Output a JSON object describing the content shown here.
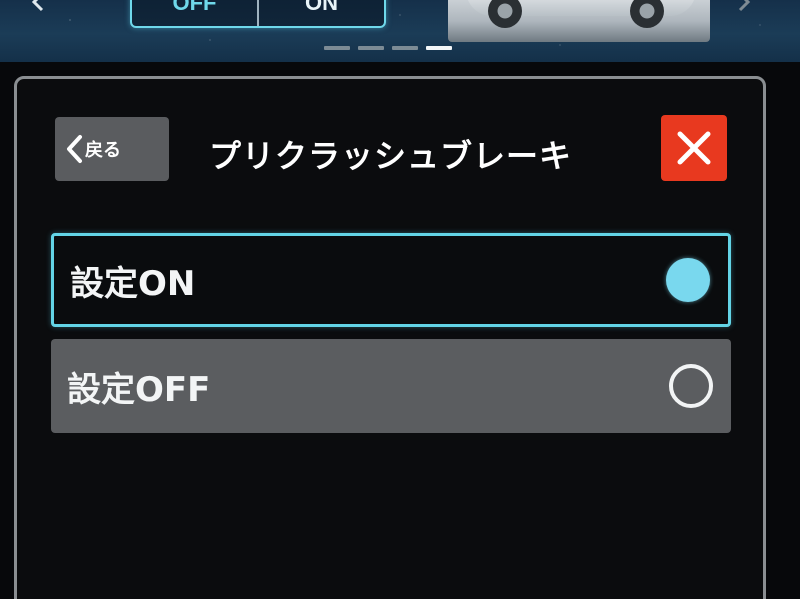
{
  "header": {
    "toggle": {
      "off_label": "OFF",
      "on_label": "ON"
    },
    "page_indicator": {
      "count": 4,
      "active_index": 3
    }
  },
  "dialog": {
    "back_label": "戻る",
    "title": "プリクラッシュブレーキ",
    "options": [
      {
        "label": "設定ON",
        "selected": true
      },
      {
        "label": "設定OFF",
        "selected": false
      }
    ]
  },
  "colors": {
    "accent": "#63d4e6",
    "close_red": "#e8391f",
    "panel_border": "#8a8e92",
    "unselected_bg": "#5b5d60"
  },
  "icons": {
    "back": "chevron-left-icon",
    "close": "close-icon",
    "prev": "chevron-left-icon",
    "next": "chevron-right-icon"
  }
}
